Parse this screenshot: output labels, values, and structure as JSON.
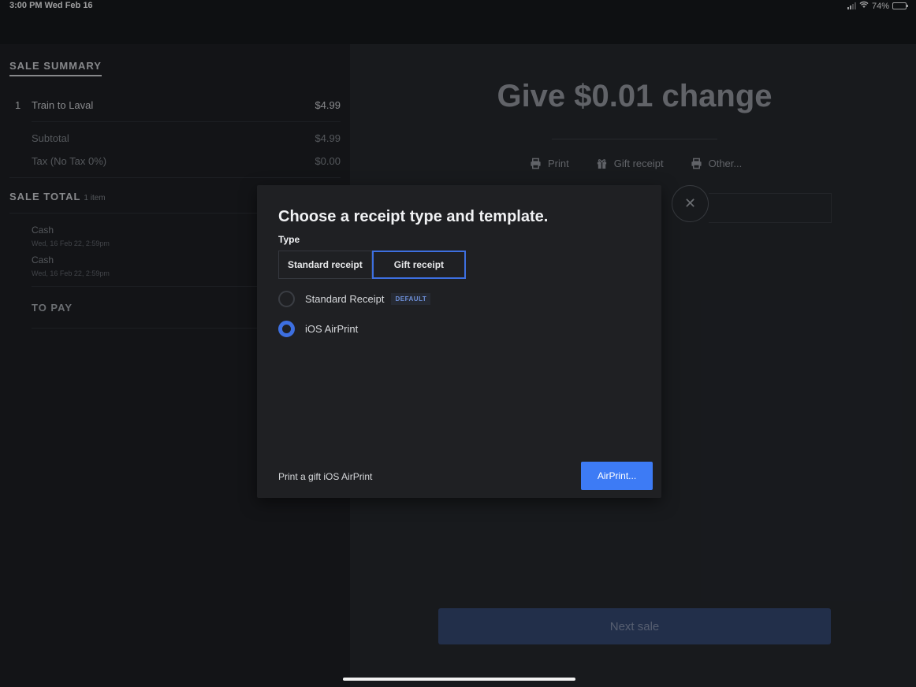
{
  "status_bar": {
    "time": "3:00 PM  Wed Feb 16",
    "battery": "74%",
    "battery_level": 0.74
  },
  "sale_summary": {
    "title": "SALE SUMMARY",
    "line_item": {
      "qty": "1",
      "name": "Train to Laval",
      "amount": "$4.99"
    },
    "subtotal": {
      "label": "Subtotal",
      "amount": "$4.99"
    },
    "tax": {
      "label": "Tax (No Tax 0%)",
      "amount": "$0.00"
    },
    "total_title": "SALE TOTAL",
    "total_count": "1 item",
    "payments": [
      {
        "method": "Cash",
        "date": "Wed, 16 Feb 22, 2:59pm"
      },
      {
        "method": "Cash",
        "date": "Wed, 16 Feb 22, 2:59pm"
      }
    ],
    "to_pay": "TO PAY"
  },
  "main": {
    "change_title": "Give $0.01 change",
    "actions": {
      "print": "Print",
      "gift_receipt": "Gift receipt",
      "other": "Other..."
    },
    "close_symbol": "✕",
    "next_sale": "Next sale"
  },
  "modal": {
    "title": "Choose a receipt type and template.",
    "type_label": "Type",
    "tabs": {
      "standard": "Standard receipt",
      "gift": "Gift receipt"
    },
    "options": [
      {
        "label": "Standard Receipt",
        "badge": "DEFAULT",
        "selected": false
      },
      {
        "label": "iOS AirPrint",
        "selected": true
      }
    ],
    "footer_text": "Print a gift iOS AirPrint",
    "airprint_button": "AirPrint..."
  },
  "colors": {
    "accent": "#3d7bf5",
    "selected_border": "#3d6fe0",
    "background": "#16181b"
  }
}
